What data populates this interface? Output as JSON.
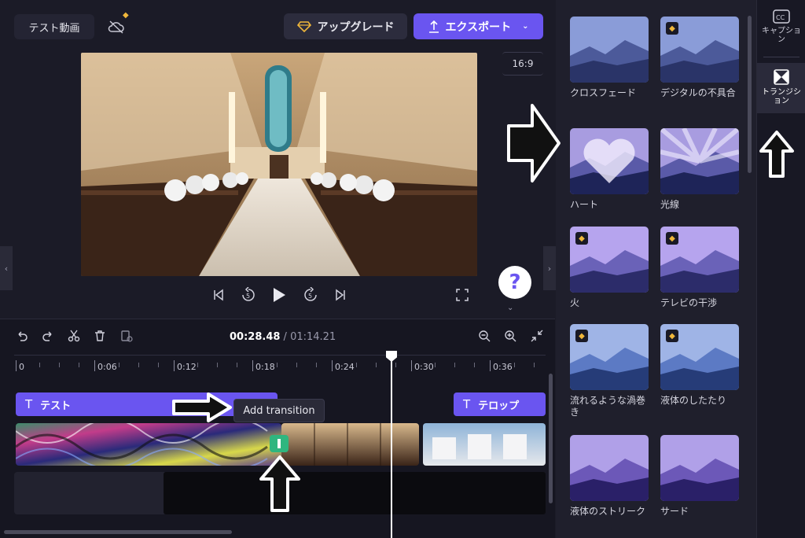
{
  "header": {
    "project_title": "テスト動画",
    "upgrade_label": "アップグレード",
    "export_label": "エクスポート"
  },
  "preview": {
    "aspect_ratio": "16:9",
    "help_label": "?"
  },
  "timeline": {
    "current_time": "00:28.48",
    "separator": " / ",
    "total_time": "01:14.21",
    "ruler_ticks": [
      "0",
      "0:06",
      "0:12",
      "0:18",
      "0:24",
      "0:30",
      "0:36"
    ],
    "text_clips": [
      {
        "label": "テスト"
      },
      {
        "label": "テロップ"
      }
    ],
    "tooltip": "Add transition"
  },
  "transitions": [
    {
      "label": "クロスフェード",
      "premium": false
    },
    {
      "label": "デジタルの不具合",
      "premium": true
    },
    {
      "label": "ハート",
      "premium": false
    },
    {
      "label": "光線",
      "premium": false
    },
    {
      "label": "火",
      "premium": true
    },
    {
      "label": "テレビの干渉",
      "premium": true
    },
    {
      "label": "流れるような渦巻き",
      "premium": true
    },
    {
      "label": "液体のしたたり",
      "premium": true
    },
    {
      "label": "液体のストリーク",
      "premium": false
    },
    {
      "label": "サード",
      "premium": false
    }
  ],
  "rail": {
    "captions_label": "キャプション",
    "transitions_label": "トランジション"
  },
  "colors": {
    "accent": "#6a55f0",
    "transition_marker": "#2fb67f",
    "premium_gem": "#f0b73b",
    "background": "#1b1b27"
  },
  "icons": [
    "cloud-off-icon",
    "diamond-icon",
    "upload-icon",
    "chevron-down-icon",
    "skip-back-icon",
    "rewind-5-icon",
    "play-icon",
    "forward-5-icon",
    "skip-forward-icon",
    "fullscreen-icon",
    "undo-icon",
    "redo-icon",
    "scissors-icon",
    "trash-icon",
    "duplicate-icon",
    "zoom-out-icon",
    "zoom-in-icon",
    "fit-icon",
    "text-icon",
    "cc-icon",
    "transition-icon"
  ]
}
